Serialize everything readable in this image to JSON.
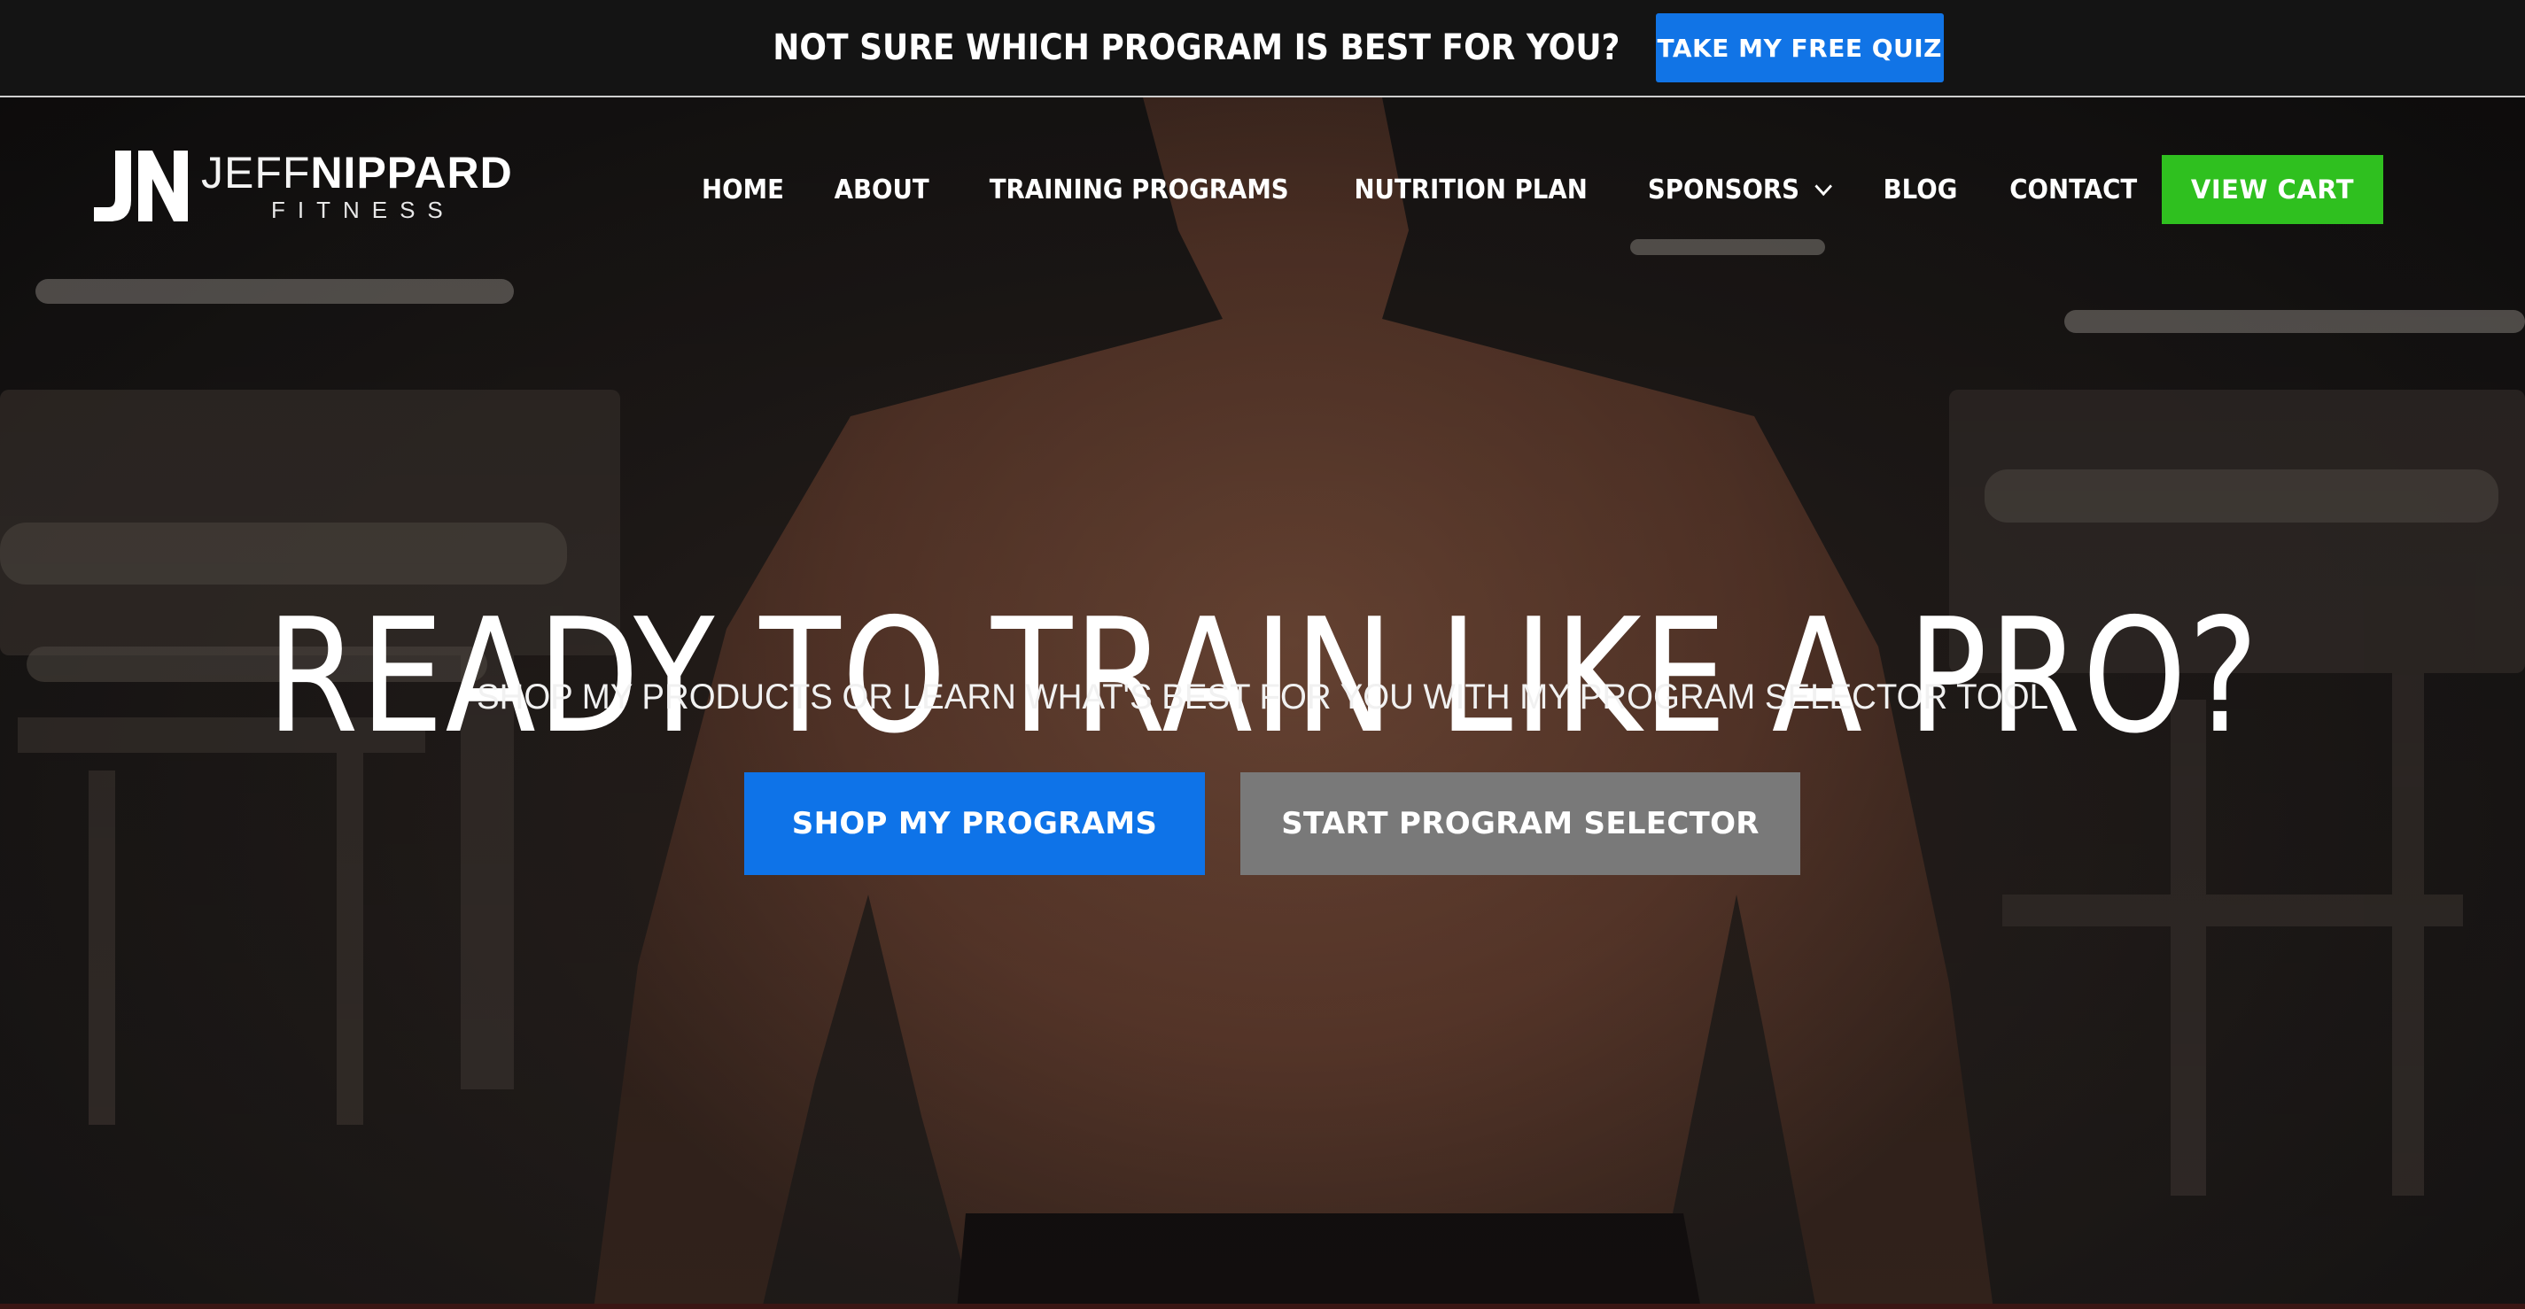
{
  "promo": {
    "text": "NOT SURE WHICH PROGRAM IS BEST FOR YOU?",
    "button_label": "TAKE MY FREE QUIZ"
  },
  "logo": {
    "mark": "JN",
    "name_light": "JEFF",
    "name_bold": "NIPPARD",
    "subtitle": "FITNESS"
  },
  "nav": {
    "items": [
      {
        "label": "HOME"
      },
      {
        "label": "ABOUT"
      },
      {
        "label": "TRAINING PROGRAMS"
      },
      {
        "label": "NUTRITION PLAN"
      },
      {
        "label": "SPONSORS"
      },
      {
        "label": "BLOG"
      },
      {
        "label": "CONTACT"
      }
    ],
    "cart_label": "VIEW CART"
  },
  "hero": {
    "title": "READY TO TRAIN LIKE A PRO?",
    "subtitle": "SHOP MY PRODUCTS OR LEARN WHAT'S BEST FOR YOU WITH MY PROGRAM SELECTOR TOOL",
    "primary_cta": "SHOP MY PROGRAMS",
    "secondary_cta": "START PROGRAM SELECTOR"
  },
  "colors": {
    "promo_bg": "#141414",
    "accent_blue": "#0e73e8",
    "cart_green": "#2fc01f",
    "secondary_gray": "#797979"
  }
}
